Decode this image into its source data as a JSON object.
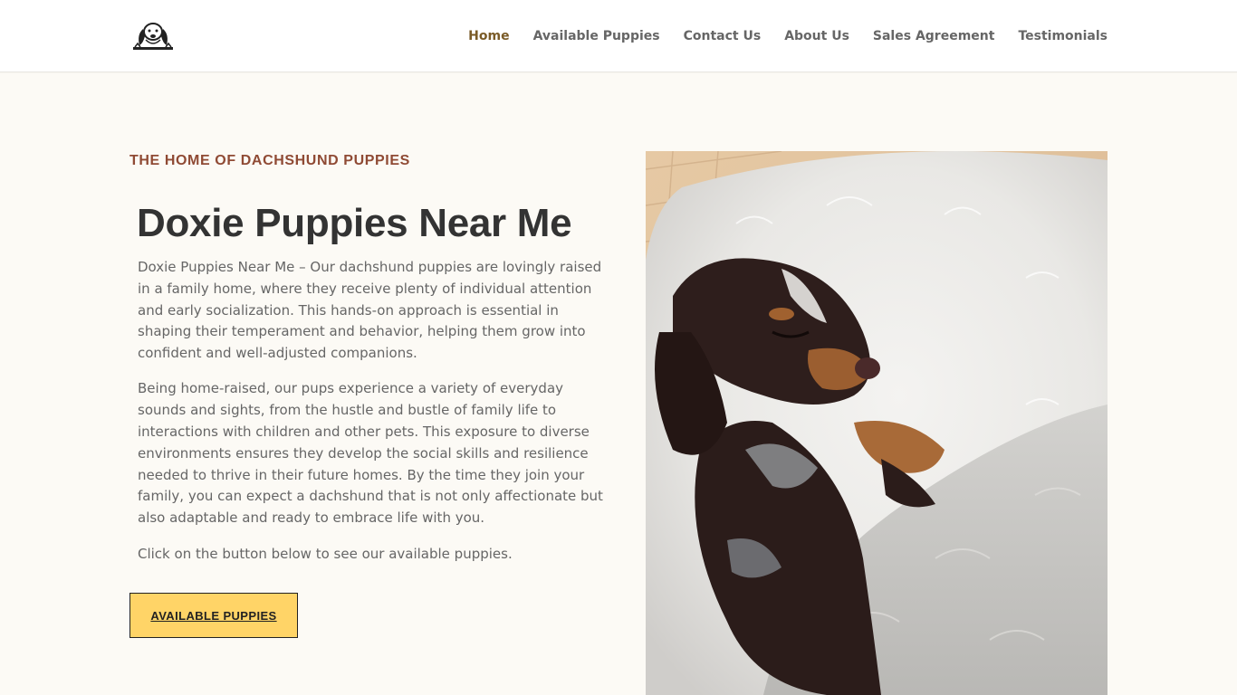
{
  "header": {
    "logo_alt": "Dachshund logo",
    "nav": [
      {
        "label": "Home",
        "active": true
      },
      {
        "label": "Available Puppies",
        "active": false
      },
      {
        "label": "Contact Us",
        "active": false
      },
      {
        "label": "About Us",
        "active": false
      },
      {
        "label": "Sales Agreement",
        "active": false
      },
      {
        "label": "Testimonials",
        "active": false
      }
    ]
  },
  "hero": {
    "eyebrow": "THE HOME OF DACHSHUND PUPPIES",
    "title": "Doxie Puppies Near Me",
    "paragraphs": [
      "Doxie Puppies Near Me – Our dachshund puppies are lovingly raised in a family home, where they receive plenty of individual attention and early socialization. This hands-on approach is essential in shaping their temperament and behavior, helping them grow into confident and well-adjusted companions.",
      "Being home-raised, our pups experience a variety of everyday sounds and sights, from the hustle and bustle of family life to interactions with children and other pets. This exposure to diverse environments ensures they develop the social skills and resilience needed to thrive in their future homes. By the time they join your family, you can expect a dachshund that is not only affectionate but also adaptable and ready to embrace life with you.",
      "Click on the button below to see our available puppies."
    ],
    "cta_label": "AVAILABLE PUPPIES",
    "photo_subject": "sleeping dachshund puppy on white fluffy blanket"
  },
  "colors": {
    "page_bg": "#fcfaf5",
    "nav_active": "#7a5b27",
    "eyebrow": "#8f4a34",
    "cta_bg": "#ffd467"
  }
}
